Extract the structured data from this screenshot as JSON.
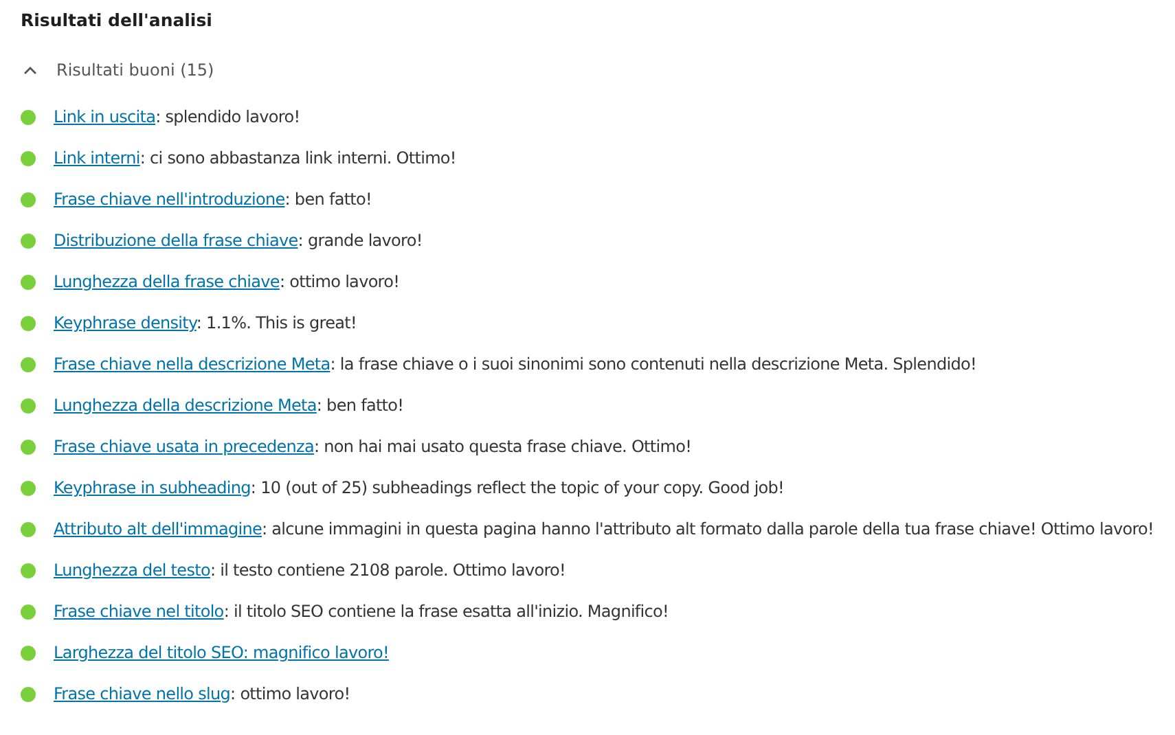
{
  "title": "Risultati dell'analisi",
  "section": {
    "label": "Risultati buoni (15)",
    "expanded": true
  },
  "results": [
    {
      "link": "Link in uscita",
      "text": ": splendido lavoro!",
      "color": "#7ad03a"
    },
    {
      "link": "Link interni",
      "text": ": ci sono abbastanza link interni. Ottimo!",
      "color": "#7ad03a"
    },
    {
      "link": "Frase chiave nell'introduzione",
      "text": ": ben fatto!",
      "color": "#7ad03a"
    },
    {
      "link": "Distribuzione della frase chiave",
      "text": ": grande lavoro!",
      "color": "#7ad03a"
    },
    {
      "link": "Lunghezza della frase chiave",
      "text": ": ottimo lavoro!",
      "color": "#7ad03a"
    },
    {
      "link": "Keyphrase density",
      "text": ": 1.1%. This is great!",
      "color": "#7ad03a"
    },
    {
      "link": "Frase chiave nella descrizione Meta",
      "text": ": la frase chiave o i suoi sinonimi sono contenuti nella descrizione Meta. Splendido!",
      "color": "#7ad03a"
    },
    {
      "link": "Lunghezza della descrizione Meta",
      "text": ": ben fatto!",
      "color": "#7ad03a"
    },
    {
      "link": "Frase chiave usata in precedenza",
      "text": ": non hai mai usato questa frase chiave. Ottimo!",
      "color": "#7ad03a"
    },
    {
      "link": "Keyphrase in subheading",
      "text": ": 10 (out of 25) subheadings reflect the topic of your copy. Good job!",
      "color": "#7ad03a"
    },
    {
      "link": "Attributo alt dell'immagine",
      "text": ": alcune immagini in questa pagina hanno l'attributo alt formato dalla parole della tua frase chiave! Ottimo lavoro!",
      "color": "#7ad03a"
    },
    {
      "link": "Lunghezza del testo",
      "text": ": il testo contiene 2108 parole. Ottimo lavoro!",
      "color": "#7ad03a"
    },
    {
      "link": "Frase chiave nel titolo",
      "text": ": il titolo SEO contiene la frase esatta all'inizio. Magnifico!",
      "color": "#7ad03a"
    },
    {
      "link": "Larghezza del titolo SEO: magnifico lavoro!",
      "color": "#7ad03a"
    },
    {
      "link": "Frase chiave nello slug",
      "text": ": ottimo lavoro!",
      "color": "#7ad03a"
    }
  ]
}
